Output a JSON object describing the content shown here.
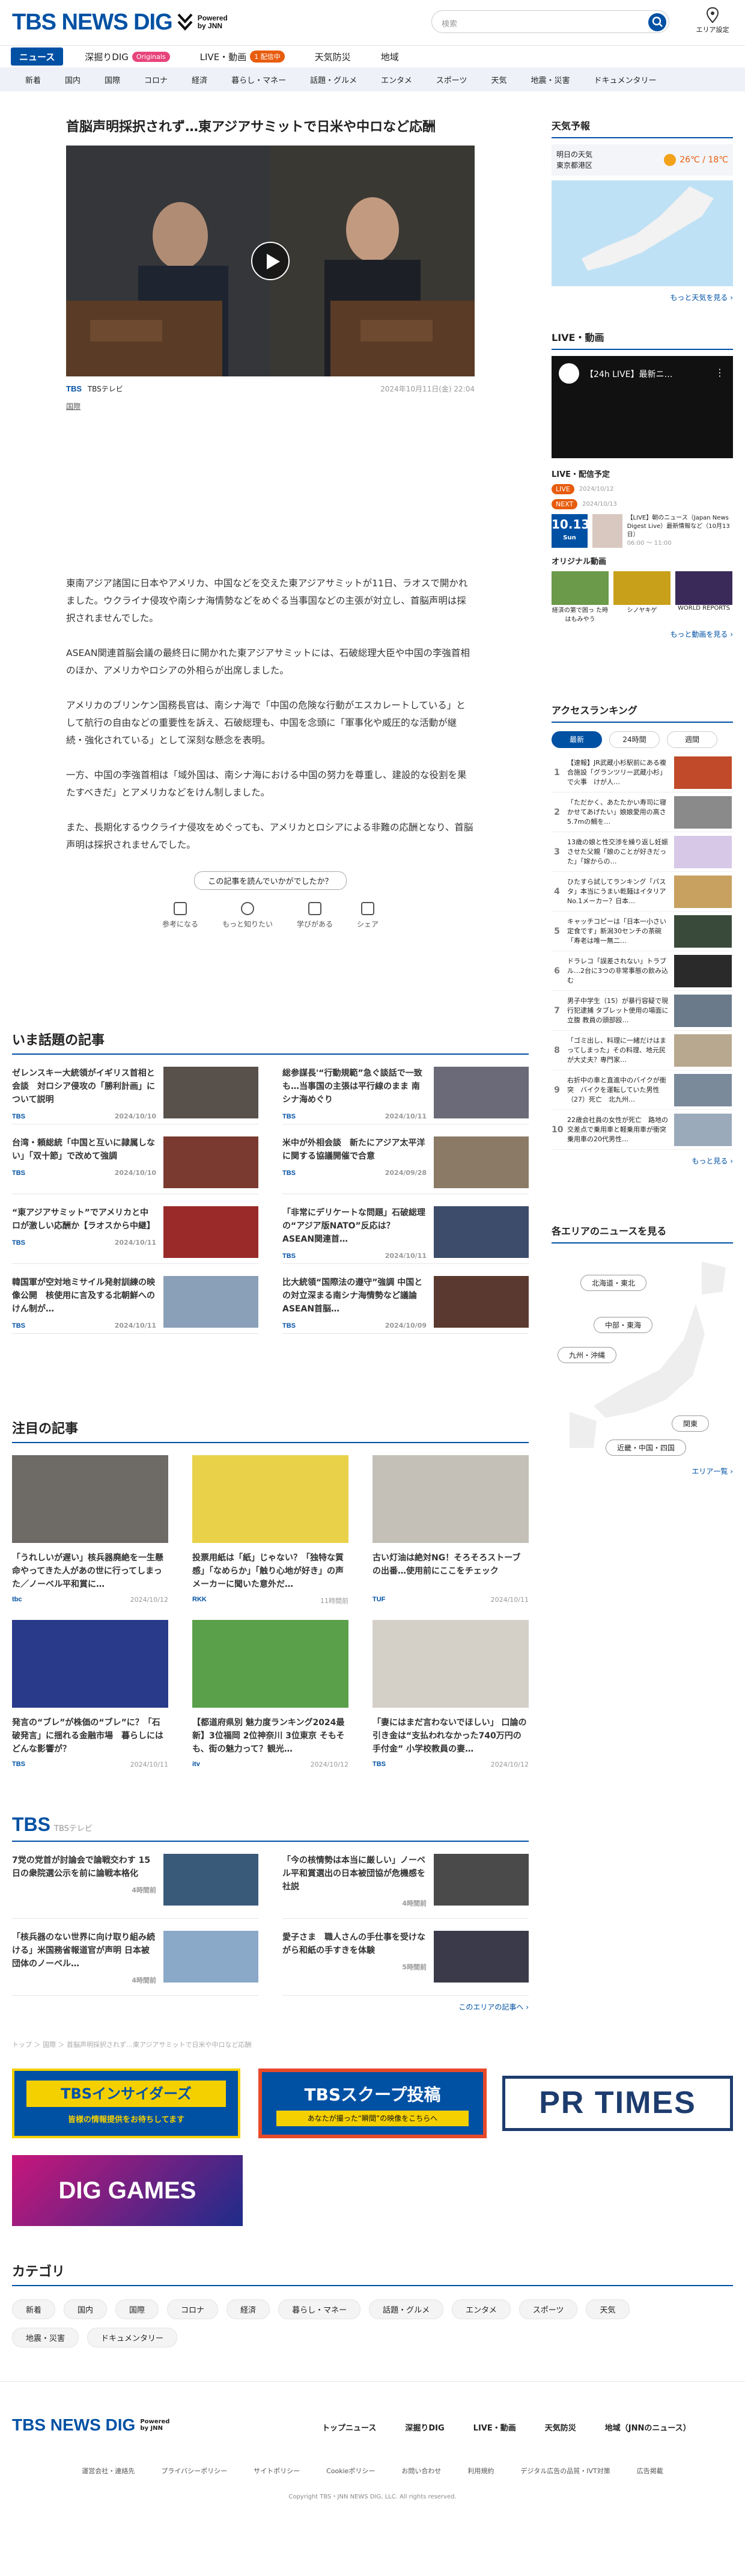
{
  "brand": {
    "name": "TBS NEWS DIG",
    "sub": "Powered by JNN"
  },
  "search": {
    "placeholder": "検索"
  },
  "area_label": "エリア設定",
  "nav": {
    "main": [
      {
        "label": "ニュース"
      },
      {
        "label": "深掘りDIG",
        "pill": "Originals"
      },
      {
        "label": "LIVE・動画",
        "pill": "1 配信中"
      },
      {
        "label": "天気防災"
      },
      {
        "label": "地域"
      }
    ],
    "sub": [
      "新着",
      "国内",
      "国際",
      "コロナ",
      "経済",
      "暮らし・マネー",
      "話題・グルメ",
      "エンタメ",
      "スポーツ",
      "天気",
      "地震・災害",
      "ドキュメンタリー"
    ]
  },
  "article": {
    "title": "首脳声明採択されず…東アジアサミットで日米や中ロなど応酬",
    "source": "TBSテレビ",
    "datetime": "2024年10月11日(金) 22:04",
    "category": "国際",
    "paragraphs": [
      "東南アジア諸国に日本やアメリカ、中国などを交えた東アジアサミットが11日、ラオスで開かれました。ウクライナ侵攻や南シナ海情勢などをめぐる当事国などの主張が対立し、首脳声明は採択されませんでした。",
      "ASEAN関連首脳会議の最終日に開かれた東アジアサミットには、石破総理大臣や中国の李強首相のほか、アメリカやロシアの外相らが出席しました。",
      "アメリカのブリンケン国務長官は、南シナ海で「中国の危険な行動がエスカレートしている」として航行の自由などの重要性を訴え、石破総理も、中国を念頭に「軍事化や威圧的な活動が継続・強化されている」として深刻な懸念を表明。",
      "一方、中国の李強首相は「域外国は、南シナ海における中国の努力を尊重し、建設的な役割を果たすべきだ」とアメリカなどをけん制しました。",
      "また、長期化するウクライナ侵攻をめぐっても、アメリカとロシアによる非難の応酬となり、首脳声明は採択されませんでした。"
    ],
    "feedback_q": "この記事を読んでいかがでしたか？",
    "feedback": [
      "参考になる",
      "もっと知りたい",
      "学びがある",
      "シェア"
    ]
  },
  "hot": {
    "title": "いま話題の記事",
    "items": [
      {
        "t": "ゼレンスキー大統領がイギリス首相と会談　対ロシア侵攻の「勝利計画」について説明",
        "d": "2024/10/10"
      },
      {
        "t": "総参謀長'“行動規範”急ぐ談話で一致も…当事国の主張は平行線のまま 南シナ海めぐり",
        "d": "2024/10/11"
      },
      {
        "t": "台湾・頼総統「中国と互いに隷属しない」「双十節」で改めて強調",
        "d": "2024/10/10"
      },
      {
        "t": "米中が外相会談　新たにアジア太平洋に関する協議開催で合意",
        "d": "2024/09/28"
      },
      {
        "t": "“東アジアサミット”でアメリカと中ロが激しい応酬か【ラオスから中継】",
        "d": "2024/10/11"
      },
      {
        "t": "「非常にデリケートな問題」石破総理の“アジア版NATO”反応は？ ASEAN関連首…",
        "d": "2024/10/11"
      },
      {
        "t": "韓国軍が空対地ミサイル発射訓練の映像公開　核使用に言及する北朝鮮へのけん制が…",
        "d": "2024/10/11"
      },
      {
        "t": "比大統領“国際法の遵守”強調 中国との対立深まる南シナ海情勢など議論　ASEAN首脳…",
        "d": "2024/10/09"
      }
    ]
  },
  "attention": {
    "title": "注目の記事",
    "items": [
      {
        "t": "「うれしいが遅い」核兵器廃絶を一生懸命やってきた人があの世に行ってしまった／ノーベル平和賞に…",
        "s": "tbc",
        "d": "2024/10/12"
      },
      {
        "t": "投票用紙は「紙」じゃない？「独特な質感」「なめらか」「触り心地が好き」の声 メーカーに聞いた意外だ…",
        "s": "RKK",
        "d": "11時間前"
      },
      {
        "t": "古い灯油は絶対NG！そろそろストーブの出番…使用前にここをチェック",
        "s": "TUF",
        "d": "2024/10/11"
      },
      {
        "t": "発言の“ブレ”が株価の“ブレ”に？「石破発言」に揺れる金融市場　暮らしにはどんな影響が？",
        "s": "TBS",
        "d": "2024/10/11"
      },
      {
        "t": "【都道府県別 魅力度ランキング2024最新】3位福岡 2位神奈川 3位東京 そもそも、街の魅力って？観光…",
        "s": "itv",
        "d": "2024/10/12"
      },
      {
        "t": "「妻にはまだ言わないでほしい」 口論の引き金は“支払われなかった740万円の手付金” 小学校教員の妻…",
        "s": "TBS",
        "d": "2024/10/12"
      }
    ]
  },
  "tbs_local": {
    "name": "TBS",
    "sub": "TBSテレビ",
    "items": [
      {
        "t": "7党の党首が討論会で論戦交わす 15日の衆院選公示を前に論戦本格化",
        "d": "4時間前"
      },
      {
        "t": "「今の核情勢は本当に厳しい」ノーベル平和賞選出の日本被団協が危機感を社説",
        "d": "4時間前"
      },
      {
        "t": "「核兵器のない世界に向け取り組み続ける」米国務省報道官が声明 日本被団体のノーベル…",
        "d": "4時間前"
      },
      {
        "t": "愛子さま　職人さんの手仕事を受けながら和紙の手すきを体験",
        "d": "5時間前"
      }
    ],
    "more": "このエリアの記事へ ›"
  },
  "breadcrumb": "トップ ＞ 国際 ＞ 首脳声明採択されず…東アジアサミットで日米や中ロなど応酬",
  "banners": {
    "insiders": "TBSインサイダーズ",
    "insiders_sub": "皆様の情報提供をお待ちしてます",
    "scoop": "TBSスクープ投稿",
    "scoop_sub": "あなたが撮った“瞬間”の映像をこちらへ",
    "prtimes": "PR TIMES",
    "games": "DIG GAMES"
  },
  "category": {
    "title": "カテゴリ",
    "items": [
      "新着",
      "国内",
      "国際",
      "コロナ",
      "経済",
      "暮らし・マネー",
      "話題・グルメ",
      "エンタメ",
      "スポーツ",
      "天気",
      "地震・災害",
      "ドキュメンタリー"
    ]
  },
  "weather": {
    "title": "天気予報",
    "day": "明日の天気",
    "place": "東京都港区",
    "temp": "26℃ / 18℃",
    "more": "もっと天気を見る ›"
  },
  "live": {
    "title": "LIVE・動画",
    "video": "【24h LIVE】最新ニ…",
    "sched_title": "LIVE・配信予定",
    "sched": [
      {
        "tag": "LIVE",
        "d": "2024/10/12"
      },
      {
        "tag": "NEXT",
        "d": "2024/10/13"
      }
    ],
    "event_date": "10.13",
    "event_day": "Sun",
    "event": "【LIVE】朝のニュース（Japan News Digest Live）最新情報など（10月13日）",
    "event_time": "06:00 〜 11:00",
    "original": "オリジナル動画",
    "orig_items": [
      "経済の第で困っ た時はもみやう",
      "シノヤキゲ",
      "WORLD REPORTS"
    ],
    "more": "もっと動画を見る ›"
  },
  "ranking": {
    "title": "アクセスランキング",
    "tabs": [
      "最新",
      "24時間",
      "週間"
    ],
    "items": [
      "【速報】JR武蔵小杉駅前にある複合施設「グランツリー武蔵小杉」で火事　けが人…",
      "「ただかく、あたたかい寿司に寝かせてあげたい」娘娘愛用の高さ5.7mの鯛を…",
      "13歳の娘と性交渉を繰り返し妊娠させた父親「娘のことが好きだった」「嫁からの…",
      "ひたすら試してランキング「パスタ」本当にうまい乾麺はイタリアNo.1メーカー？日本…",
      "キャッチコピーは「日本一小さい定食です」新潟30センチの茶碗「寿老は唯一無二…",
      "ドラレコ「誤差されない」トラブル…2台に3つの非常事態の飲み込む",
      "男子中学生（15）が暴行容疑で現行犯逮捕 タブレット使用の場面に立腹 教員の頭部殴…",
      "「ゴミ出し、料理に一緒だけはまってしまった」その料理、地元民が大丈夫？専門家…",
      "右折中の車と直進中のバイクが衝突　バイクを運転していた男性（27）死亡　北九州…",
      "22歳会社員の女性が死亡　路地の交差点で乗用車と軽乗用車が衝突　乗用車の20代男性…"
    ],
    "more": "もっと見る ›"
  },
  "areas": {
    "title": "各エリアのニュースを見る",
    "labels": [
      "北海道・東北",
      "中部・東海",
      "九州・沖縄",
      "関東",
      "近畿・中国・四国"
    ],
    "more": "エリア一覧 ›"
  },
  "footer": {
    "nav": [
      "トップニュース",
      "深掘りDIG",
      "LIVE・動画",
      "天気防災",
      "地域（JNNのニュース）"
    ],
    "links": [
      "運営会社・連絡先",
      "プライバシーポリシー",
      "サイトポリシー",
      "Cookieポリシー",
      "お問い合わせ",
      "利用規約",
      "デジタル広告の品質・IVT対策",
      "広告掲載"
    ],
    "copy": "Copyright TBS・JNN NEWS DIG, LLC. All rights reserved."
  },
  "colors": {
    "brand": "#0051a4",
    "live": "#e85c0d",
    "originals": "#e8447b"
  }
}
